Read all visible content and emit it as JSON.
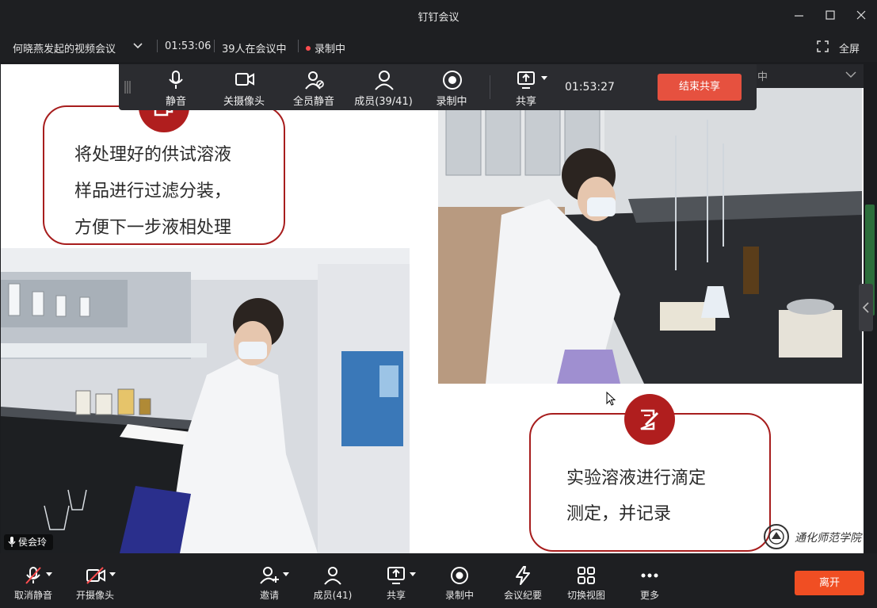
{
  "window": {
    "title": "钉钉会议"
  },
  "infobar": {
    "meeting_name": "何晓燕发起的视频会议",
    "elapsed": "01:53:06",
    "participants_text": "39人在会议中",
    "recording_text": "录制中",
    "fullscreen_label": "全屏"
  },
  "sharebar": {
    "mute_label": "静音",
    "camera_off_label": "关摄像头",
    "mute_all_label": "全员静音",
    "members_label": "成员(39/41)",
    "recording_label": "录制中",
    "share_label": "共享",
    "share_time": "01:53:27",
    "end_share_label": "结束共享"
  },
  "slide": {
    "callout_left": {
      "line1": "将处理好的供试溶液",
      "line2": "样品进行过滤分装，",
      "line3": "方便下一步液相处理"
    },
    "callout_right": {
      "line1": "实验溶液进行滴定",
      "line2": "测定，并记录"
    },
    "logo_text": "通化师范学院",
    "peek_text": "中"
  },
  "speaker": {
    "name": "侯会玲"
  },
  "bottombar": {
    "unmute_label": "取消静音",
    "camera_on_label": "开摄像头",
    "invite_label": "邀请",
    "members_label": "成员(41)",
    "share_label": "共享",
    "recording_label": "录制中",
    "minutes_label": "会议纪要",
    "switch_view_label": "切换视图",
    "more_label": "更多",
    "leave_label": "离开"
  },
  "colors": {
    "accent_red": "#b01e1e",
    "end_share": "#e6513f",
    "leave": "#f04e23",
    "toolbar_bg": "#1e1f22"
  }
}
